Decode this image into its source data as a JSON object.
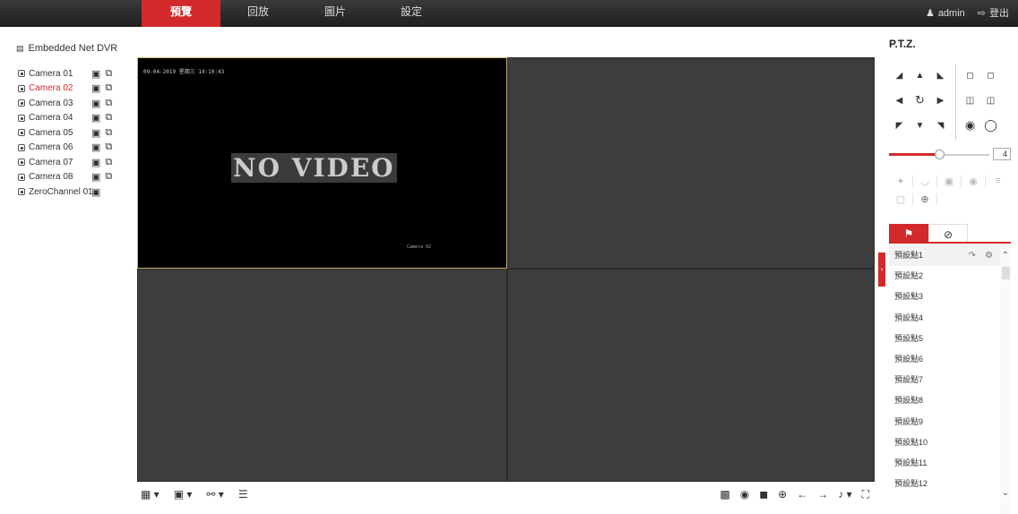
{
  "nav": {
    "tabs": [
      {
        "label": "預覽",
        "active": true
      },
      {
        "label": "回放",
        "active": false
      },
      {
        "label": "圖片",
        "active": false
      },
      {
        "label": "設定",
        "active": false
      }
    ],
    "user": "admin",
    "logout": "登出"
  },
  "sidebar": {
    "device": "Embedded Net DVR",
    "cameras": [
      {
        "name": "Camera 01",
        "selected": false
      },
      {
        "name": "Camera 02",
        "selected": true
      },
      {
        "name": "Camera 03",
        "selected": false
      },
      {
        "name": "Camera 04",
        "selected": false
      },
      {
        "name": "Camera 05",
        "selected": false
      },
      {
        "name": "Camera 06",
        "selected": false
      },
      {
        "name": "Camera 07",
        "selected": false
      },
      {
        "name": "Camera 08",
        "selected": false
      },
      {
        "name": "ZeroChannel 01",
        "selected": false
      }
    ]
  },
  "video": {
    "osd_time": "09-04-2019 星期三 14:10:43",
    "no_video": "NO VIDEO",
    "osd_camera": "Camera 02"
  },
  "ptz": {
    "title": "P.T.Z.",
    "speed": "4",
    "speed_level": 4,
    "speed_max": 7,
    "presets": [
      "預設點1",
      "預設點2",
      "預設點3",
      "預設點4",
      "預設點5",
      "預設點6",
      "預設點7",
      "預設點8",
      "預設點9",
      "預設點10",
      "預設點11",
      "預設點12"
    ]
  },
  "colors": {
    "accent": "#d22a2a",
    "topbar": "#2a2a2a"
  }
}
